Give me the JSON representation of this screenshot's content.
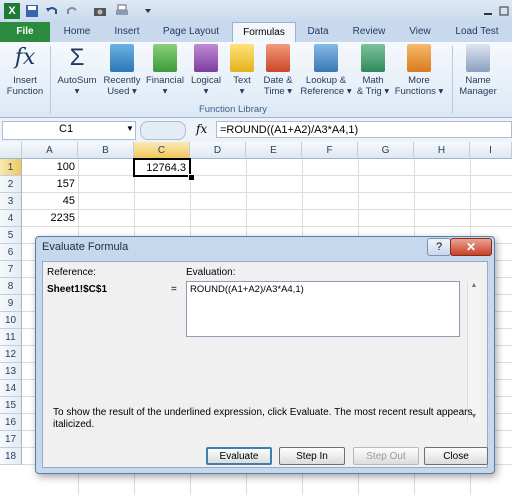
{
  "tabs": {
    "file": "File",
    "home": "Home",
    "insert": "Insert",
    "page_layout": "Page Layout",
    "formulas": "Formulas",
    "data": "Data",
    "review": "Review",
    "view": "View",
    "load_test": "Load Test"
  },
  "ribbon": {
    "insert_function_1": "Insert",
    "insert_function_2": "Function",
    "autosum": "AutoSum",
    "recently_used_1": "Recently",
    "recently_used_2": "Used",
    "financial": "Financial",
    "logical": "Logical",
    "text": "Text",
    "datetime_1": "Date &",
    "datetime_2": "Time",
    "lookup_1": "Lookup &",
    "lookup_2": "Reference",
    "math_1": "Math",
    "math_2": "& Trig",
    "more_1": "More",
    "more_2": "Functions",
    "name_manager_1": "Name",
    "name_manager_2": "Manager",
    "group_label": "Function Library",
    "fx_glyph": "fx",
    "sigma_glyph": "Σ"
  },
  "formula_bar": {
    "name_box": "C1",
    "fx": "fx",
    "formula": "=ROUND((A1+A2)/A3*A4,1)"
  },
  "columns": [
    "A",
    "B",
    "C",
    "D",
    "E",
    "F",
    "G",
    "H",
    "I"
  ],
  "rows": [
    "1",
    "2",
    "3",
    "4",
    "5",
    "6",
    "7",
    "8",
    "9",
    "10",
    "11",
    "12",
    "13",
    "14",
    "15",
    "16",
    "17",
    "18"
  ],
  "cells": {
    "A1": "100",
    "A2": "157",
    "A3": "45",
    "A4": "2235",
    "C1": "12764.3"
  },
  "dialog": {
    "title": "Evaluate Formula",
    "help": "?",
    "close": "✕",
    "reference_label": "Reference:",
    "evaluation_label": "Evaluation:",
    "reference_value": "Sheet1!$C$1",
    "equals": "=",
    "evaluation_value": "ROUND((A1+A2)/A3*A4,1)",
    "info": "To show the result of the underlined expression, click Evaluate.  The most recent result appears italicized.",
    "evaluate": "Evaluate",
    "step_in": "Step In",
    "step_out": "Step Out",
    "close_btn": "Close"
  },
  "colors": {
    "file_tab": "#2a8a3e",
    "selected_cell_border": "#000000",
    "dialog_frame": "#c6d8ee"
  }
}
